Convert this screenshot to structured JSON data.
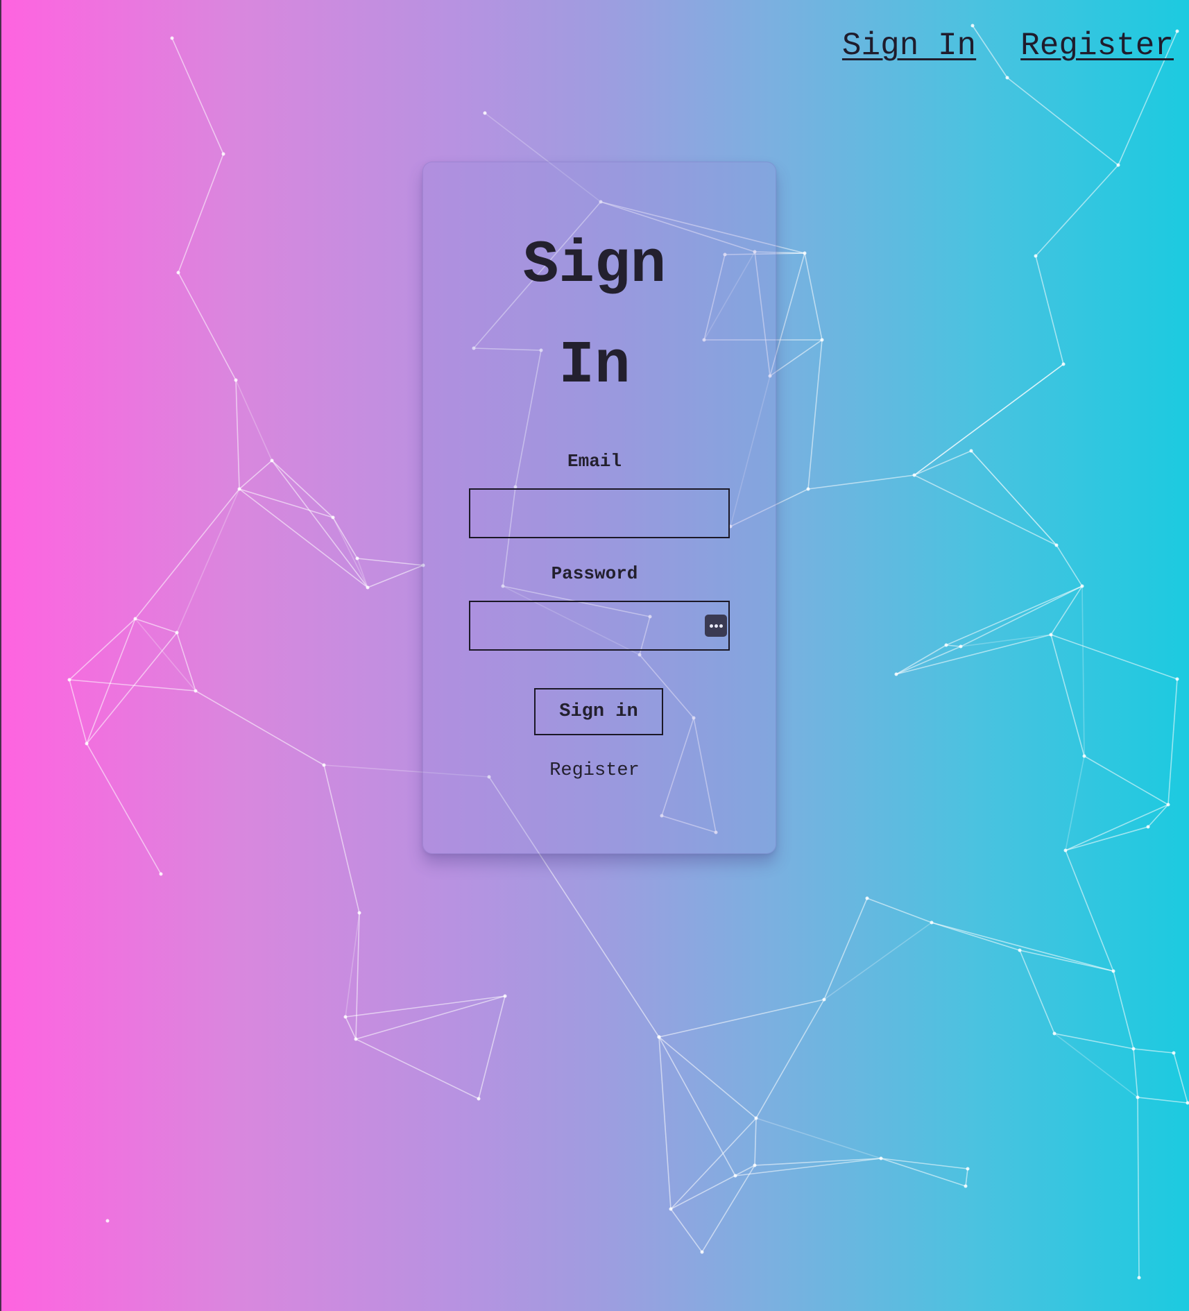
{
  "nav": {
    "sign_in": "Sign In",
    "register": "Register"
  },
  "card": {
    "title_line1": "Sign",
    "title_line2": "In",
    "email_label": "Email",
    "email_value": "",
    "password_label": "Password",
    "password_value": "",
    "password_manager_icon": "password-manager-icon",
    "submit_label": "Sign in",
    "register_link": "Register"
  },
  "colors": {
    "gradient_left": "#ff63e0",
    "gradient_right": "#1ccae0",
    "text": "#23202e"
  }
}
